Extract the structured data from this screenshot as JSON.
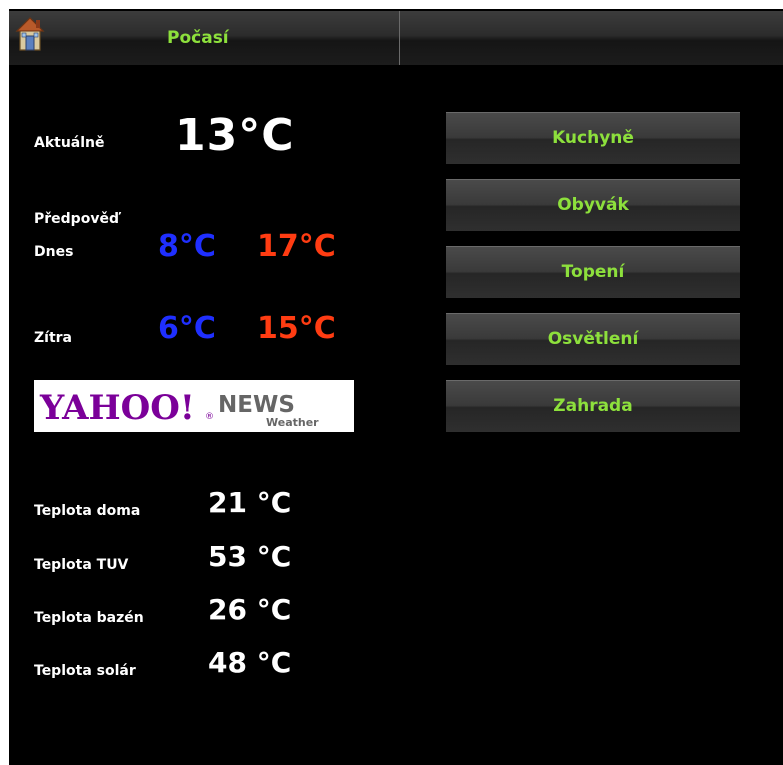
{
  "header": {
    "title": "Počasí",
    "home_icon": "house-icon"
  },
  "current": {
    "label": "Aktuálně",
    "value": "13°C"
  },
  "forecast": {
    "heading": "Předpověď",
    "today": {
      "label": "Dnes",
      "min": "8°C",
      "max": "17°C"
    },
    "tomorrow": {
      "label": "Zítra",
      "min": "6°C",
      "max": "15°C"
    }
  },
  "provider_logo": {
    "brand": "YAHOO!",
    "news": "NEWS",
    "sub": "Weather",
    "registered": "®"
  },
  "house": [
    {
      "label": "Teplota doma",
      "value": "21 °C"
    },
    {
      "label": "Teplota TUV",
      "value": "53 °C"
    },
    {
      "label": "Teplota bazén",
      "value": "26 °C"
    },
    {
      "label": "Teplota solár",
      "value": "48 °C"
    }
  ],
  "rooms": [
    {
      "label": "Kuchyně"
    },
    {
      "label": "Obyvák"
    },
    {
      "label": "Topení"
    },
    {
      "label": "Osvětlení"
    },
    {
      "label": "Zahrada"
    }
  ],
  "colors": {
    "accent_green": "#8de03c",
    "cold_blue": "#1f2fff",
    "hot_red": "#ff3c12",
    "yahoo_purple": "#7b0099"
  }
}
